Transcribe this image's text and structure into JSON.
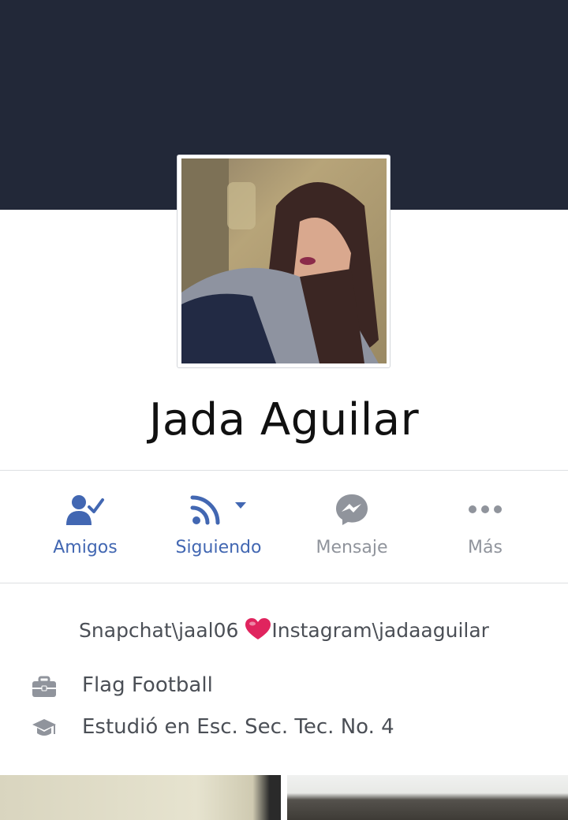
{
  "profile": {
    "name": "Jada Aguilar",
    "bio_before": "Snapchat\\jaal06 ",
    "bio_after": "Instagram\\jadaaguilar"
  },
  "actions": [
    {
      "label": "Amigos",
      "icon": "friends-check-icon",
      "color": "#4267b2"
    },
    {
      "label": "Siguiendo",
      "icon": "rss-follow-icon",
      "color": "#4267b2"
    },
    {
      "label": "Mensaje",
      "icon": "messenger-icon",
      "color": "#90949c"
    },
    {
      "label": "Más",
      "icon": "more-dots-icon",
      "color": "#90949c"
    }
  ],
  "info": [
    {
      "icon": "briefcase-icon",
      "text": "Flag Football"
    },
    {
      "icon": "graduation-cap-icon",
      "text": "Estudió en Esc. Sec. Tec. No. 4"
    }
  ],
  "colors": {
    "cover": "#222838",
    "accent": "#4267b2",
    "muted": "#90949c",
    "text": "#4b4f56",
    "heart": "#e0245e"
  }
}
